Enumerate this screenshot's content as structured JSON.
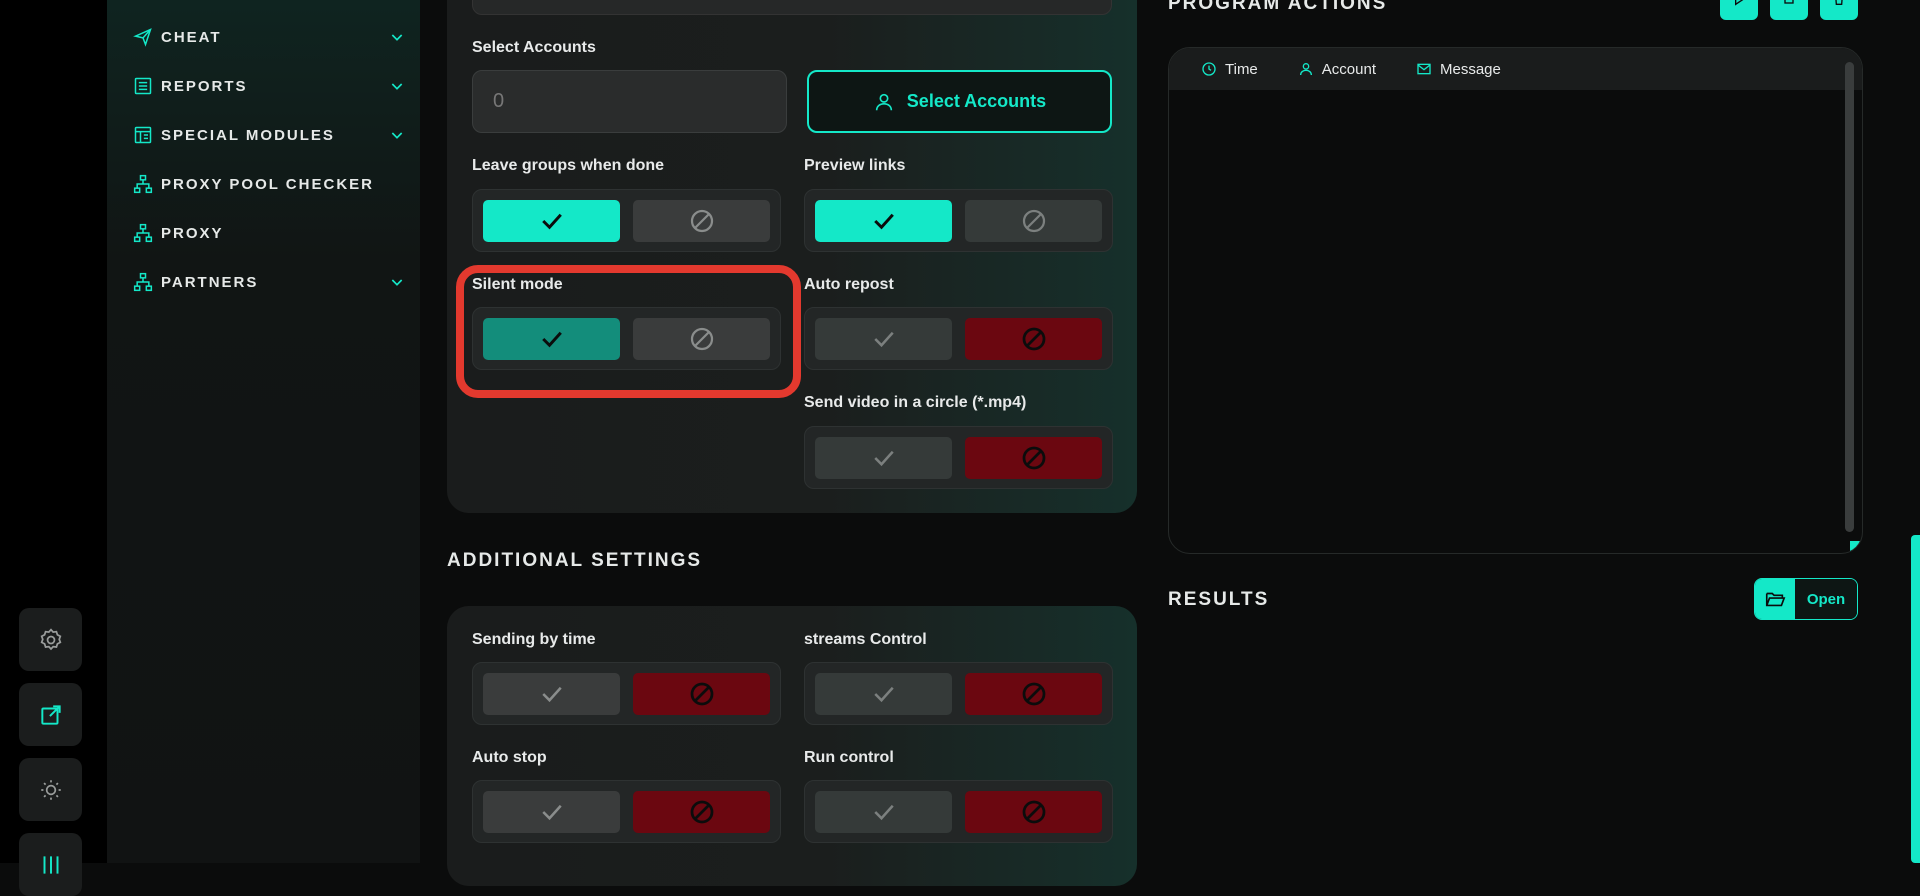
{
  "nav": {
    "items": [
      {
        "label": "CHEAT",
        "icon": "send-icon",
        "has_children": true
      },
      {
        "label": "REPORTS",
        "icon": "report-icon",
        "has_children": true
      },
      {
        "label": "SPECIAL MODULES",
        "icon": "modules-icon",
        "has_children": true
      },
      {
        "label": "PROXY POOL CHECKER",
        "icon": "network-icon",
        "has_children": false
      },
      {
        "label": "PROXY",
        "icon": "network-icon",
        "has_children": false
      },
      {
        "label": "PARTNERS",
        "icon": "network-icon",
        "has_children": true
      }
    ]
  },
  "rail": {
    "items": [
      "settings-icon",
      "external-link-icon",
      "theme-toggle-icon",
      "sliders-icon"
    ]
  },
  "accounts": {
    "label": "Select Accounts",
    "value": "0",
    "button_label": "Select Accounts"
  },
  "options": {
    "leave_groups": {
      "label": "Leave groups when done",
      "state": "on"
    },
    "preview_links": {
      "label": "Preview links",
      "state": "on"
    },
    "silent_mode": {
      "label": "Silent mode",
      "state": "on"
    },
    "auto_repost": {
      "label": "Auto repost",
      "state": "off"
    },
    "send_video": {
      "label": "Send video in a circle (*.mp4)",
      "state": "off"
    }
  },
  "additional": {
    "title": "ADDITIONAL SETTINGS",
    "sending_by_time": {
      "label": "Sending by time",
      "state": "off"
    },
    "streams_control": {
      "label": "streams Control",
      "state": "off"
    },
    "auto_stop": {
      "label": "Auto stop",
      "state": "off"
    },
    "run_control": {
      "label": "Run control",
      "state": "off"
    }
  },
  "program_actions": {
    "title": "PROGRAM ACTIONS",
    "columns": [
      "Time",
      "Account",
      "Message"
    ]
  },
  "results": {
    "title": "RESULTS",
    "open_label": "Open"
  },
  "colors": {
    "accent": "#14e8c8",
    "accent_dim": "#138d7b",
    "danger": "#6b0710",
    "highlight": "#e3392e"
  }
}
